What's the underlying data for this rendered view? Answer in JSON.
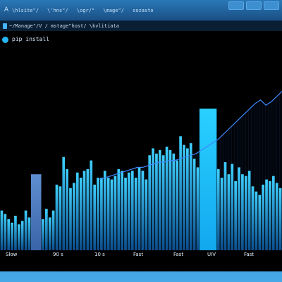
{
  "window": {
    "title_icon": "A",
    "tabs": [
      "\\hlsite\"/",
      "\\'hns\"/",
      "\\ogr/\"",
      "\\mage\"/",
      "sozasto"
    ]
  },
  "path": {
    "text": "~/Manage\"/V / mstage\"host/ \\kvlitiata"
  },
  "command": {
    "text": "pip install"
  },
  "chart_data": {
    "type": "bar",
    "categories": [
      "Slow",
      "90 s",
      "10 s",
      "Fast",
      "Fast",
      "UIV",
      "Fast"
    ],
    "bars": [
      23,
      21,
      18,
      16,
      20,
      15,
      17,
      23,
      19,
      14,
      26,
      22,
      18,
      24,
      19,
      23,
      38,
      37,
      54,
      47,
      36,
      39,
      45,
      42,
      46,
      47,
      52,
      38,
      42,
      42,
      46,
      42,
      41,
      43,
      47,
      46,
      42,
      45,
      46,
      42,
      48,
      46,
      41,
      55,
      59,
      56,
      58,
      55,
      60,
      58,
      56,
      52,
      66,
      61,
      59,
      62,
      53,
      48,
      52,
      49,
      44,
      46,
      50,
      47,
      42,
      51,
      44,
      50,
      40,
      48,
      44,
      43,
      46,
      37,
      34,
      32,
      38,
      41,
      40,
      43,
      39,
      36
    ],
    "highlights": [
      {
        "index": 9,
        "span": 3,
        "value": 44
      },
      {
        "index": 58,
        "span": 5,
        "value": 82
      }
    ],
    "trend": [
      41,
      42,
      43,
      44,
      45,
      46,
      47,
      48,
      48,
      49,
      50,
      51,
      51,
      52,
      52,
      53,
      54,
      55,
      56,
      58,
      60,
      62,
      64,
      67,
      70,
      73,
      76,
      79,
      82,
      85,
      87,
      84,
      86,
      89,
      92
    ],
    "ylim": [
      0,
      100
    ],
    "colors": {
      "bar_top": "#3fd0ff",
      "bar_bottom": "#0b4d8c",
      "highlight_dim": "#4f7fc0",
      "highlight_bright": "#22c3ff",
      "trend": "#3d88ff"
    }
  }
}
